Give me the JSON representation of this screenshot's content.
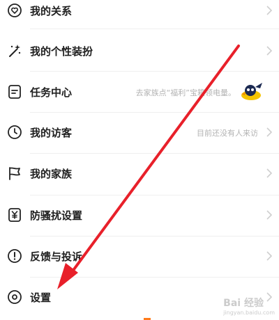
{
  "menu": {
    "items": [
      {
        "label": "我的关系",
        "hint": "",
        "icon": "heart-badge-icon"
      },
      {
        "label": "我的个性装扮",
        "hint": "",
        "icon": "magic-wand-icon"
      },
      {
        "label": "任务中心",
        "hint": "去家族点“福利”宝箱领电量。",
        "icon": "task-list-icon"
      },
      {
        "label": "我的访客",
        "hint": "目前还没有人来访",
        "icon": "clock-icon"
      },
      {
        "label": "我的家族",
        "hint": "",
        "icon": "flag-icon"
      },
      {
        "label": "防骚扰设置",
        "hint": "",
        "icon": "shield-yen-icon"
      },
      {
        "label": "反馈与投诉",
        "hint": "",
        "icon": "exclamation-circle-icon"
      },
      {
        "label": "设置",
        "hint": "",
        "icon": "gear-icon"
      }
    ]
  },
  "watermark": {
    "text": "Bai 经验",
    "sub": "jingyan.baidu.com"
  },
  "colors": {
    "annotation_arrow": "#e8202a",
    "hint_text": "#b3b3b3",
    "accent_tab": "#ff7a1a"
  }
}
